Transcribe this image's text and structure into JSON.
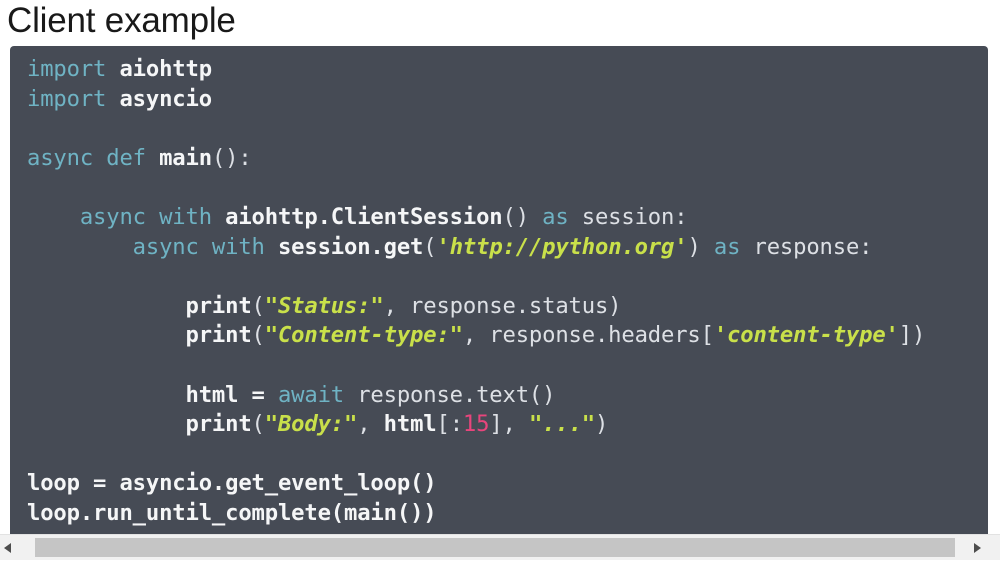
{
  "page": {
    "title": "Client example",
    "background_color": "#ffffff",
    "title_color": "#191919"
  },
  "code_block": {
    "background_color": "#464b55",
    "language": "python",
    "theme": {
      "keyword_color": "#6fb3c4",
      "identifier_color": "#f5f6f7",
      "plain_color": "#dde0e5",
      "string_color": "#c9e04a",
      "number_color": "#e8457c"
    },
    "plain_text": "import aiohttp\nimport asyncio\n\nasync def main():\n\n    async with aiohttp.ClientSession() as session:\n        async with session.get('http://python.org') as response:\n\n            print(\"Status:\", response.status)\n            print(\"Content-type:\", response.headers['content-type'])\n\n            html = await response.text()\n            print(\"Body:\", html[:15], \"...\")\n\nloop = asyncio.get_event_loop()\nloop.run_until_complete(main())",
    "lines": [
      {
        "tokens": [
          {
            "t": "import ",
            "c": "kw"
          },
          {
            "t": "aiohttp",
            "c": "id"
          }
        ]
      },
      {
        "tokens": [
          {
            "t": "import ",
            "c": "kw"
          },
          {
            "t": "asyncio",
            "c": "id"
          }
        ]
      },
      {
        "tokens": []
      },
      {
        "tokens": [
          {
            "t": "async ",
            "c": "kw"
          },
          {
            "t": "def ",
            "c": "kw"
          },
          {
            "t": "main",
            "c": "id"
          },
          {
            "t": "():",
            "c": "pl"
          }
        ]
      },
      {
        "tokens": []
      },
      {
        "tokens": [
          {
            "t": "    ",
            "c": "pl"
          },
          {
            "t": "async with ",
            "c": "kw"
          },
          {
            "t": "aiohttp.ClientSession",
            "c": "id"
          },
          {
            "t": "() ",
            "c": "pl"
          },
          {
            "t": "as ",
            "c": "kw"
          },
          {
            "t": "session:",
            "c": "pl"
          }
        ]
      },
      {
        "tokens": [
          {
            "t": "        ",
            "c": "pl"
          },
          {
            "t": "async with ",
            "c": "kw"
          },
          {
            "t": "session.get",
            "c": "id"
          },
          {
            "t": "(",
            "c": "pl"
          },
          {
            "t": "'http://python.org'",
            "c": "str"
          },
          {
            "t": ") ",
            "c": "pl"
          },
          {
            "t": "as ",
            "c": "kw"
          },
          {
            "t": "response:",
            "c": "pl"
          }
        ]
      },
      {
        "tokens": []
      },
      {
        "tokens": [
          {
            "t": "            ",
            "c": "pl"
          },
          {
            "t": "print",
            "c": "id"
          },
          {
            "t": "(",
            "c": "pl"
          },
          {
            "t": "\"Status:\"",
            "c": "str"
          },
          {
            "t": ", response.status)",
            "c": "pl"
          }
        ]
      },
      {
        "tokens": [
          {
            "t": "            ",
            "c": "pl"
          },
          {
            "t": "print",
            "c": "id"
          },
          {
            "t": "(",
            "c": "pl"
          },
          {
            "t": "\"Content-type:\"",
            "c": "str"
          },
          {
            "t": ", response.headers[",
            "c": "pl"
          },
          {
            "t": "'content-type'",
            "c": "str"
          },
          {
            "t": "])",
            "c": "pl"
          }
        ]
      },
      {
        "tokens": []
      },
      {
        "tokens": [
          {
            "t": "            ",
            "c": "pl"
          },
          {
            "t": "html ",
            "c": "id"
          },
          {
            "t": "= ",
            "c": "op"
          },
          {
            "t": "await ",
            "c": "kw"
          },
          {
            "t": "response.text()",
            "c": "pl"
          }
        ]
      },
      {
        "tokens": [
          {
            "t": "            ",
            "c": "pl"
          },
          {
            "t": "print",
            "c": "id"
          },
          {
            "t": "(",
            "c": "pl"
          },
          {
            "t": "\"Body:\"",
            "c": "str"
          },
          {
            "t": ", ",
            "c": "pl"
          },
          {
            "t": "html",
            "c": "id"
          },
          {
            "t": "[:",
            "c": "pl"
          },
          {
            "t": "15",
            "c": "num"
          },
          {
            "t": "], ",
            "c": "pl"
          },
          {
            "t": "\"...\"",
            "c": "str"
          },
          {
            "t": ")",
            "c": "pl"
          }
        ]
      },
      {
        "tokens": []
      },
      {
        "tokens": [
          {
            "t": "loop ",
            "c": "id"
          },
          {
            "t": "= ",
            "c": "op"
          },
          {
            "t": "asyncio.get_event_loop",
            "c": "id"
          },
          {
            "t": "()",
            "c": "op"
          }
        ]
      },
      {
        "tokens": [
          {
            "t": "loop.run_until_complete",
            "c": "id"
          },
          {
            "t": "(",
            "c": "op"
          },
          {
            "t": "main",
            "c": "id"
          },
          {
            "t": "())",
            "c": "op"
          }
        ]
      }
    ]
  },
  "scrollbar": {
    "orientation": "horizontal",
    "left_arrow": "scroll-left-arrow",
    "right_arrow": "scroll-right-arrow",
    "track_color": "#f1f1f1",
    "thumb_color": "#c5c5c5"
  }
}
